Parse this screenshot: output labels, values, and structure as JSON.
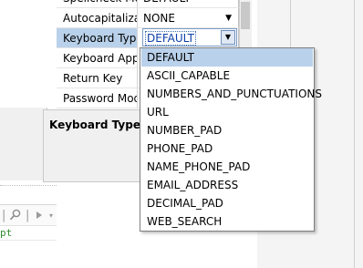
{
  "properties": {
    "rows": [
      {
        "name": "Spellcheck Mo",
        "value": "DEFAULT"
      },
      {
        "name": "Autocapitalizat",
        "value": "NONE"
      },
      {
        "name": "Keyboard Type",
        "value": "DEFAULT"
      },
      {
        "name": "Keyboard Appe",
        "value": ""
      },
      {
        "name": "Return Key",
        "value": ""
      },
      {
        "name": "Password Mode",
        "value": ""
      }
    ]
  },
  "description": {
    "title": "Keyboard Type"
  },
  "dropdown": {
    "options": [
      "DEFAULT",
      "ASCII_CAPABLE",
      "NUMBERS_AND_PUNCTUATIONS",
      "URL",
      "NUMBER_PAD",
      "PHONE_PAD",
      "NAME_PHONE_PAD",
      "EMAIL_ADDRESS",
      "DECIMAL_PAD",
      "WEB_SEARCH"
    ],
    "selected": "DEFAULT"
  },
  "console": {
    "text": "pt"
  },
  "icons": {
    "search": "search-icon",
    "run": "run-icon",
    "dropdown_caret": "chevron-down-icon"
  },
  "colors": {
    "selection": "#b9d1ea",
    "edit_text": "#0b3fa8",
    "console_text": "#2e8b2e"
  }
}
